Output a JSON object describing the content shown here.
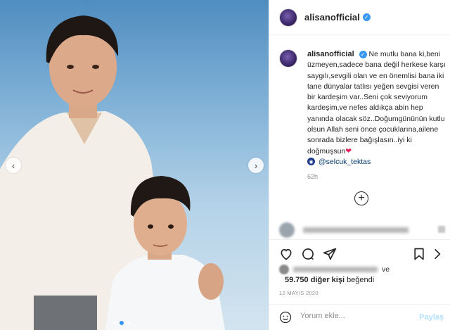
{
  "post": {
    "username": "alisanofficial",
    "caption": "Ne mutlu bana ki,beni üzmeyen,sadece bana değil herkese karşı saygılı,sevgili olan ve en önemlisi bana iki tane dünyalar tatlısı yeğen sevgisi veren bir kardeşim var..Seni çok seviyorum kardeşim,ve nefes aldıkça abin hep yanında olacak söz..Doğumgününün kutlu olsun Allah seni önce çocuklarına,ailene sonrada bizlere bağışlasın..iyi ki doğmuşsun",
    "caption_emoji": "❤",
    "tagged_user": "@selcuk_tektas",
    "time_ago": "62h",
    "likes_and": "ve",
    "likes_count": "59.750 diğer kişi",
    "likes_suffix": "beğendi",
    "date": "12 MAYIS 2020"
  },
  "comment_box": {
    "placeholder": "Yorum ekle...",
    "share_label": "Paylaş"
  },
  "icons": {
    "verified": "verified-badge-icon",
    "like": "heart-icon",
    "comment": "comment-icon",
    "share": "paper-plane-icon",
    "save": "bookmark-icon",
    "emoji": "smiley-icon",
    "load_more": "plus-circle-icon",
    "prev": "chevron-left-icon",
    "next": "chevron-right-icon"
  },
  "colors": {
    "accent": "#3897f0",
    "link": "#00376b",
    "heart": "#e0245e",
    "share_disabled": "#b2dffc"
  },
  "carousel": {
    "slide_count": 3,
    "active_slide": 1
  }
}
